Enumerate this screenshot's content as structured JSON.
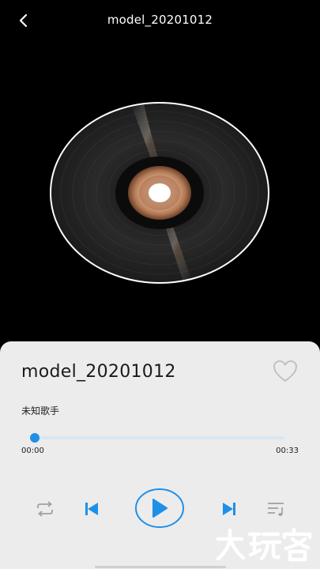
{
  "header": {
    "title": "model_20201012"
  },
  "player": {
    "song_title": "model_20201012",
    "artist": "未知歌手",
    "current_time": "00:00",
    "total_time": "00:33",
    "progress": 0.0
  },
  "controls": {
    "repeat_icon": "repeat-icon",
    "prev_icon": "skip-previous-icon",
    "play_icon": "play-icon",
    "next_icon": "skip-next-icon",
    "playlist_icon": "playlist-icon",
    "favorite_icon": "heart-outline-icon"
  },
  "colors": {
    "accent": "#1e90e8",
    "panel_bg": "#ececec",
    "screen_bg": "#000000"
  },
  "watermark": {
    "text": "大玩客"
  }
}
